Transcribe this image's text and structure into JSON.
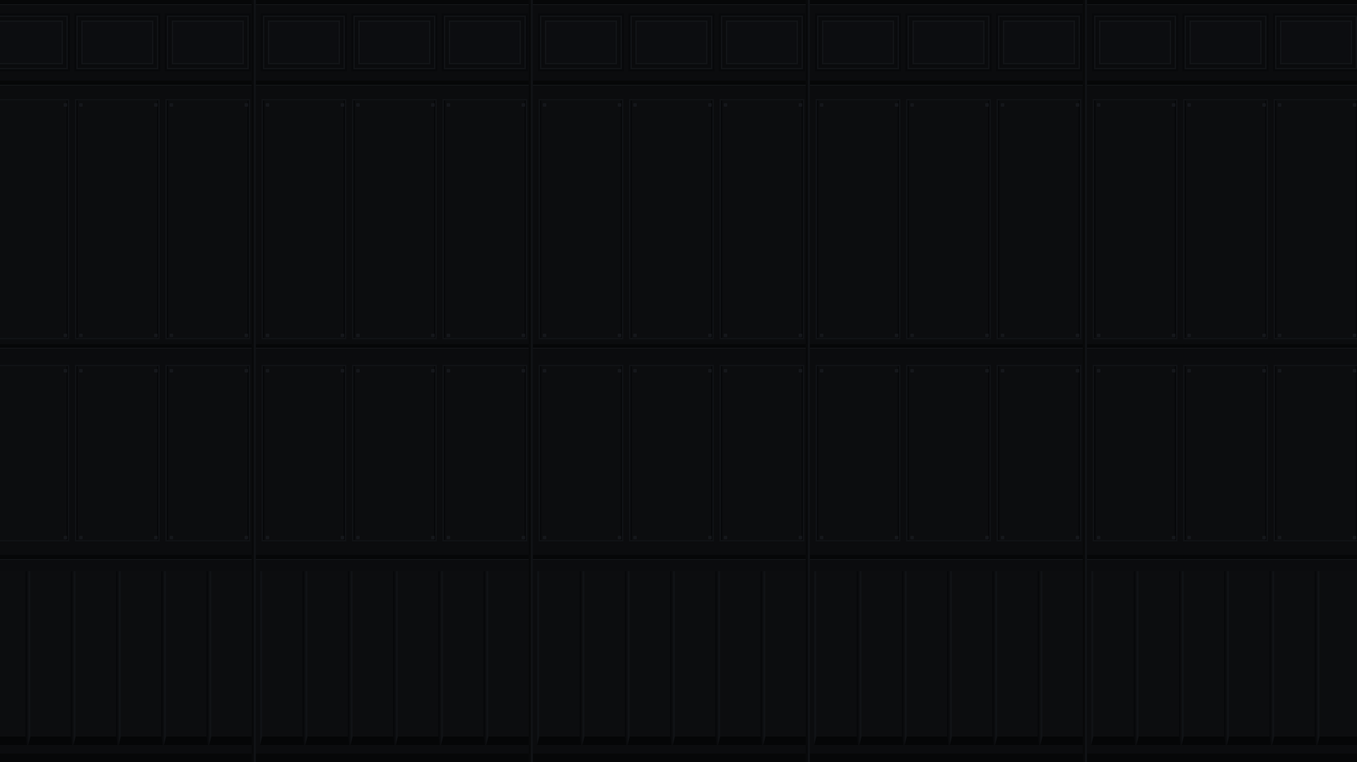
{
  "scene": {
    "description_visible_text": "",
    "colors": {
      "background": "#0b0c0e",
      "panel": "#0c0d0f",
      "seam": "#060708",
      "highlight": "#15171b"
    }
  }
}
